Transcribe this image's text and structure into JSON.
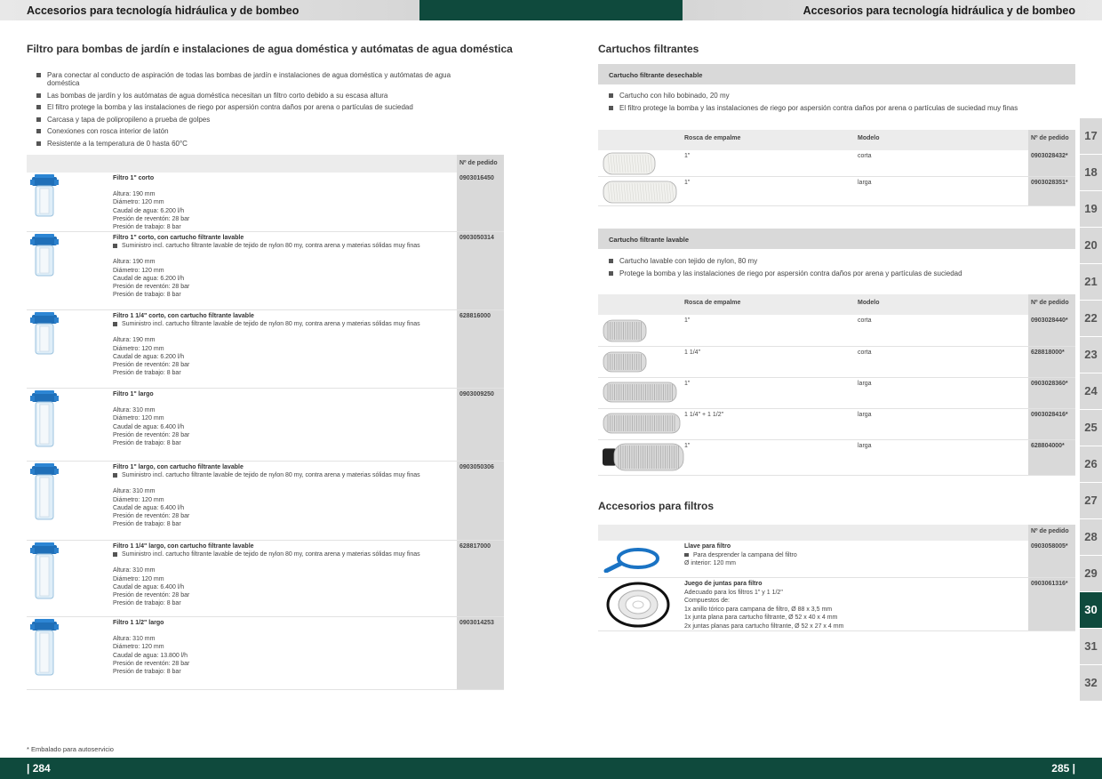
{
  "header": {
    "left_title": "Accesorios para tecnología hidráulica y de bombeo",
    "right_title": "Accesorios para tecnología hidráulica y de bombeo"
  },
  "left": {
    "title": "Filtro para bombas de jardín e instalaciones de agua doméstica y autómatas de agua doméstica",
    "bullets": [
      "Para conectar al conducto de aspiración de todas las bombas de jardín e instalaciones de agua doméstica y autómatas de agua doméstica",
      "Las bombas de jardín y los autómatas de agua doméstica necesitan un filtro corto debido a su escasa altura",
      "El filtro protege la bomba y las instalaciones de riego por aspersión contra daños por arena o partículas de suciedad",
      "Carcasa y tapa de polipropileno a prueba de golpes",
      "Conexiones con rosca interior de latón",
      "Resistente a la temperatura de 0 hasta 60°C"
    ],
    "table": {
      "order_header": "Nº de pedido",
      "rows": [
        {
          "title": "Filtro 1\" corto",
          "bullets": [],
          "specs": [
            "Altura: 190 mm",
            "Diámetro: 120 mm",
            "Caudal de agua: 6.200 l/h",
            "Presión de reventón: 28 bar",
            "Presión de trabajo: 8 bar"
          ],
          "order": "0903016450"
        },
        {
          "title": "Filtro 1\" corto, con cartucho filtrante lavable",
          "bullets": [
            "Suministro incl. cartucho filtrante lavable de tejido de nylon 80 my, contra arena y materias sólidas muy finas"
          ],
          "specs": [
            "Altura: 190 mm",
            "Diámetro: 120 mm",
            "Caudal de agua: 6.200 l/h",
            "Presión de reventón: 28 bar",
            "Presión de trabajo: 8 bar"
          ],
          "order": "0903050314"
        },
        {
          "title": "Filtro 1 1/4\" corto, con cartucho filtrante lavable",
          "bullets": [
            "Suministro incl. cartucho filtrante lavable de tejido de nylon 80 my, contra arena y materias sólidas muy finas"
          ],
          "specs": [
            "Altura: 190 mm",
            "Diámetro: 120 mm",
            "Caudal de agua: 6.200 l/h",
            "Presión de reventón: 28 bar",
            "Presión de trabajo: 8 bar"
          ],
          "order": "628816000"
        },
        {
          "title": "Filtro 1\" largo",
          "bullets": [],
          "specs": [
            "Altura: 310 mm",
            "Diámetro: 120 mm",
            "Caudal de agua: 6.400 l/h",
            "Presión de reventón: 28 bar",
            "Presión de trabajo: 8 bar"
          ],
          "order": "0903009250"
        },
        {
          "title": "Filtro 1\" largo, con cartucho filtrante lavable",
          "bullets": [
            "Suministro incl. cartucho filtrante lavable de tejido de nylon 80 my, contra arena y materias sólidas muy finas"
          ],
          "specs": [
            "Altura: 310 mm",
            "Diámetro: 120 mm",
            "Caudal de agua: 6.400 l/h",
            "Presión de reventón: 28 bar",
            "Presión de trabajo: 8 bar"
          ],
          "order": "0903050306"
        },
        {
          "title": "Filtro 1 1/4\" largo, con cartucho filtrante lavable",
          "bullets": [
            "Suministro incl. cartucho filtrante lavable de tejido de nylon 80 my, contra arena y materias sólidas muy finas"
          ],
          "specs": [
            "Altura: 310 mm",
            "Diámetro: 120 mm",
            "Caudal de agua: 6.400 l/h",
            "Presión de reventón: 28 bar",
            "Presión de trabajo: 8 bar"
          ],
          "order": "628817000"
        },
        {
          "title": "Filtro 1 1/2\" largo",
          "bullets": [],
          "specs": [
            "Altura: 310 mm",
            "Diámetro: 120 mm",
            "Caudal de agua: 13.800 l/h",
            "Presión de reventón: 28 bar",
            "Presión de trabajo: 8 bar"
          ],
          "order": "0903014253"
        }
      ]
    },
    "footnote": "* Embalado para autoservicio",
    "page_number": "| 284"
  },
  "right": {
    "cartuchos_title": "Cartuchos filtrantes",
    "desechable": {
      "bar": "Cartucho filtrante desechable",
      "bullets": [
        "Cartucho con hilo bobinado, 20 my",
        "El filtro protege la bomba y las instalaciones de riego por aspersión contra daños por arena o partículas de suciedad muy finas"
      ],
      "headers": {
        "rosca": "Rosca de empalme",
        "modelo": "Modelo",
        "order": "Nº de pedido"
      },
      "rows": [
        {
          "rosca": "1\"",
          "modelo": "corta",
          "order": "0903028432*"
        },
        {
          "rosca": "1\"",
          "modelo": "larga",
          "order": "0903028351*"
        }
      ]
    },
    "lavable": {
      "bar": "Cartucho filtrante lavable",
      "bullets": [
        "Cartucho lavable con tejido de nylon, 80 my",
        "Protege la bomba y las instalaciones de riego por aspersión contra daños por arena y partículas de suciedad"
      ],
      "headers": {
        "rosca": "Rosca de empalme",
        "modelo": "Modelo",
        "order": "Nº de pedido"
      },
      "rows": [
        {
          "rosca": "1\"",
          "modelo": "corta",
          "order": "0903028440*"
        },
        {
          "rosca": "1 1/4\"",
          "modelo": "corta",
          "order": "628818000*"
        },
        {
          "rosca": "1\"",
          "modelo": "larga",
          "order": "0903028360*"
        },
        {
          "rosca": "1 1/4\" + 1 1/2\"",
          "modelo": "larga",
          "order": "0903028416*"
        },
        {
          "rosca": "1\"",
          "modelo": "larga",
          "order": "628804000*"
        }
      ]
    },
    "accesorios": {
      "title": "Accesorios para filtros",
      "order_header": "Nº de pedido",
      "rows": [
        {
          "title": "Llave para filtro",
          "bullets": [
            "Para desprender la campana del filtro"
          ],
          "lines": [
            "Ø interior: 120 mm"
          ],
          "order": "0903058005*"
        },
        {
          "title": "Juego de juntas para filtro",
          "bullets": [],
          "lines": [
            "Adecuado para los filtros 1\" y 1 1/2\"",
            "Compuestos de:",
            "1x anillo tórico para campana de filtro, Ø 88 x 3,5 mm",
            "1x junta plana para cartucho filtrante, Ø 52 x 40 x 4 mm",
            "2x juntas planas para cartucho filtrante, Ø 52 x 27 x 4 mm"
          ],
          "order": "0903061316*"
        }
      ]
    },
    "tabs": [
      "17",
      "18",
      "19",
      "20",
      "21",
      "22",
      "23",
      "24",
      "25",
      "26",
      "27",
      "28",
      "29",
      "30",
      "31",
      "32"
    ],
    "active_tab": "30",
    "page_number": "285 |"
  },
  "colors": {
    "brand_green": "#0f4a3d",
    "grey_cell": "#d9d9d9",
    "filter_blue": "#1f6fb8"
  }
}
